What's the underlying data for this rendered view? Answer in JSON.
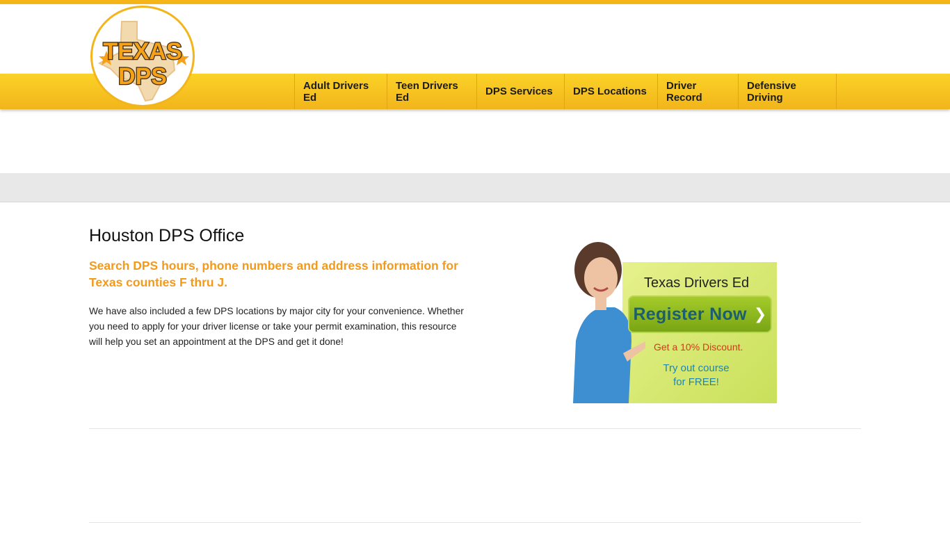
{
  "logo": {
    "line1": "TEXAS",
    "line2": "DPS"
  },
  "nav": [
    {
      "label": "Adult Drivers Ed"
    },
    {
      "label": "Teen Drivers Ed"
    },
    {
      "label": "DPS Services"
    },
    {
      "label": "DPS Locations"
    },
    {
      "label": "Driver Record"
    },
    {
      "label": "Defensive Driving"
    }
  ],
  "main": {
    "title": "Houston DPS Office",
    "subtitle": "Search DPS hours, phone numbers and address information for Texas counties F thru J.",
    "body": "We have also included a few DPS locations by major city for your convenience. Whether you need to apply for your driver license or take your permit examination, this resource will help you set an appointment at the DPS and get it done!"
  },
  "ad": {
    "title": "Texas Drivers Ed",
    "button": "Register Now",
    "discount": "Get a 10% Discount.",
    "try_line1": "Try out course",
    "try_line2": "for FREE!"
  },
  "colors": {
    "accent": "#f5b417",
    "subtitle": "#f29a1c",
    "ad_button": "#79a515"
  }
}
